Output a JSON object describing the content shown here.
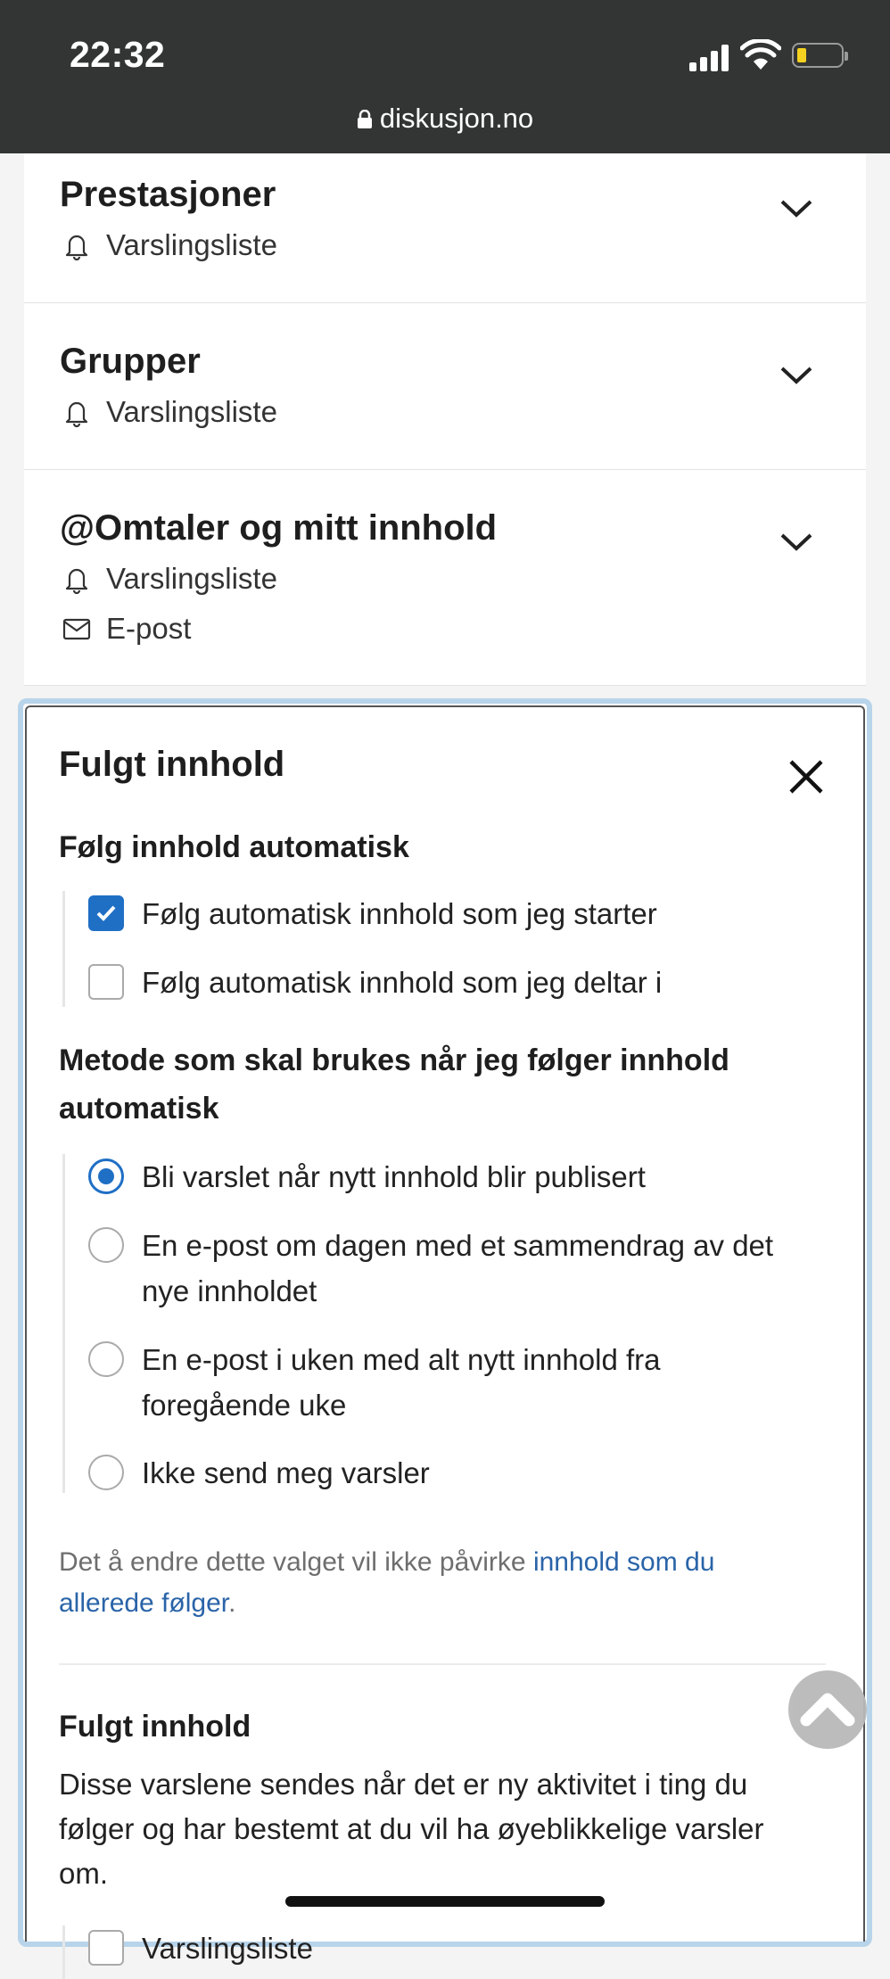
{
  "status_bar": {
    "time": "22:32",
    "url": "diskusjon.no"
  },
  "sections": [
    {
      "title": "Prestasjoner",
      "rows": [
        {
          "icon": "bell-icon",
          "label": "Varslingsliste"
        }
      ]
    },
    {
      "title": "Grupper",
      "rows": [
        {
          "icon": "bell-icon",
          "label": "Varslingsliste"
        }
      ]
    },
    {
      "title": "@Omtaler og mitt innhold",
      "rows": [
        {
          "icon": "bell-icon",
          "label": "Varslingsliste"
        },
        {
          "icon": "envelope-icon",
          "label": "E-post"
        }
      ]
    }
  ],
  "panel": {
    "title": "Fulgt innhold",
    "auto_follow": {
      "heading": "Følg innhold automatisk",
      "options": [
        {
          "label": "Følg automatisk innhold som jeg starter",
          "checked": true
        },
        {
          "label": "Følg automatisk innhold som jeg deltar i",
          "checked": false
        }
      ]
    },
    "method": {
      "heading": "Metode som skal brukes når jeg følger innhold automatisk",
      "options": [
        {
          "label": "Bli varslet når nytt innhold blir publisert",
          "selected": true
        },
        {
          "label": "En e-post om dagen med et sammendrag av det nye innholdet",
          "selected": false
        },
        {
          "label": "En e-post i uken med alt nytt innhold fra foregående uke",
          "selected": false
        },
        {
          "label": "Ikke send meg varsler",
          "selected": false
        }
      ]
    },
    "note": {
      "text": "Det å endre dette valget vil ikke påvirke ",
      "link": "innhold som du allerede følger",
      "suffix": "."
    },
    "followed": {
      "heading": "Fulgt innhold",
      "description": "Disse varslene sendes når det er ny aktivitet i ting du følger og har bestemt at du vil ha øyeblikkelige varsler om.",
      "options": [
        {
          "label": "Varslingsliste",
          "checked": false
        }
      ]
    }
  },
  "colors": {
    "accent": "#1f6fc5",
    "link": "#2a64a8",
    "status_bar": "#333535",
    "panel_border": "#b8d4ea"
  }
}
